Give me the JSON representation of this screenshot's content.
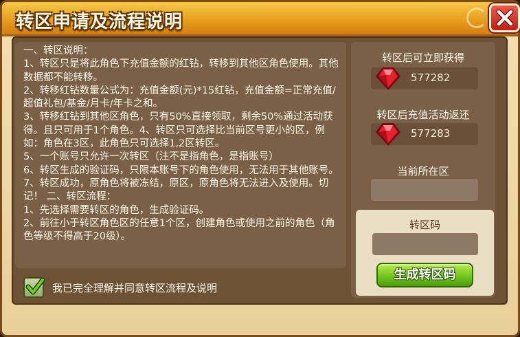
{
  "window": {
    "title": "转区申请及流程说明"
  },
  "description": {
    "text": "一、转区说明：\n1、转区只是将此角色下充值金额的红钻，转移到其他区角色使用。其他数据都不能转移。\n2、转移红钻数量公式为：充值金额(元)*15红钻，充值金额=正常充值/超值礼包/基金/月卡/年卡之和。\n3、转移红钻到其他区角色，只有50%直接领取，剩余50%通过活动获得。且只可用于1个角色。4、转区只可选择比当前区号更小的区，例如：角色在3区，此角色只可选择1,2区转区。\n5、一个账号只允许一次转区（注不是指角色，是指账号）\n6、转区生成的验证码，只限本账号下的角色使用，无法用于其他账号。\n7、转区成功，原角色将被冻结，原区，原角色将无法进入及使用。切记！ 二、转区流程：\n1、先选择需要转区的角色，生成验证码。\n2、前往小于转区角色区的任意1个区，创建角色或使用之前的角色（角色等级不得高于20级）。"
  },
  "agreement": {
    "label": "我已完全理解并同意转区流程及说明",
    "checked": true
  },
  "sidebar": {
    "immediate_label": "转区后可立即获得",
    "immediate_value": "577282",
    "rebate_label": "转区后充值活动返还",
    "rebate_value": "577283",
    "current_zone_label": "当前所在区",
    "current_zone_value": "",
    "code_label": "转区码",
    "code_value": "",
    "generate_button": "生成转区码"
  },
  "icons": {
    "close": "close-icon",
    "gem": "red-diamond-icon",
    "check": "check-icon"
  },
  "colors": {
    "title_bar": "#e79a1c",
    "close_button": "#d32a1c",
    "generate_button": "#6ec21a",
    "gem": "#e8202e"
  }
}
